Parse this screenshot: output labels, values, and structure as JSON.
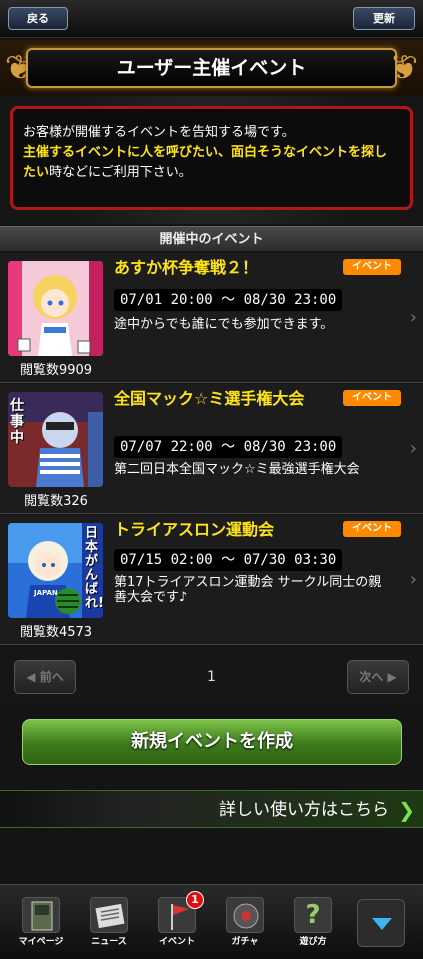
{
  "header": {
    "back_label": "戻る",
    "refresh_label": "更新"
  },
  "title": "ユーザー主催イベント",
  "intro": {
    "line1": "お客様が開催するイベントを告知する場です。",
    "highlight": "主催するイベントに人を呼びたい、面白そうなイベントを探したい",
    "tail": "時などにご利用下さい。"
  },
  "section_title": "開催中のイベント",
  "events": [
    {
      "title": "あすか杯争奪戦２！",
      "badge": "イベント",
      "period": "07/01 20:00 ～ 08/30 23:00",
      "description": "途中からでも誰にでも参加できます。",
      "views": "閲覧数9909"
    },
    {
      "title": "全国マック☆ミ選手権大会",
      "badge": "イベント",
      "period": "07/07 22:00 ～ 08/30 23:00",
      "description": "第二回日本全国マック☆ミ最強選手権大会",
      "views": "閲覧数326",
      "thumb_text": "仕事中"
    },
    {
      "title": "トライアスロン運動会",
      "badge": "イベント",
      "period": "07/15 02:00 ～ 07/30 03:30",
      "description": "第17トライアスロン運動会 サークル同士の親善大会です♪",
      "views": "閲覧数4573",
      "thumb_text": "日本がんばれ!!!",
      "thumb_jersey": "JAPAN"
    }
  ],
  "pager": {
    "prev_label": "前へ",
    "next_label": "次へ",
    "current_page": "1"
  },
  "create_button": "新規イベントを作成",
  "help_link": "詳しい使い方はこちら",
  "nav": [
    {
      "label": "マイページ",
      "icon": "mypage-icon"
    },
    {
      "label": "ニュース",
      "icon": "news-icon"
    },
    {
      "label": "イベント",
      "icon": "event-flag-icon",
      "badge": "1"
    },
    {
      "label": "ガチャ",
      "icon": "gacha-icon"
    },
    {
      "label": "遊び方",
      "icon": "help-icon"
    }
  ],
  "colors": {
    "highlight": "#ffe41a",
    "badge": "#ff8a00",
    "alert_border": "#b01818",
    "create_button": "#4f9a26"
  }
}
